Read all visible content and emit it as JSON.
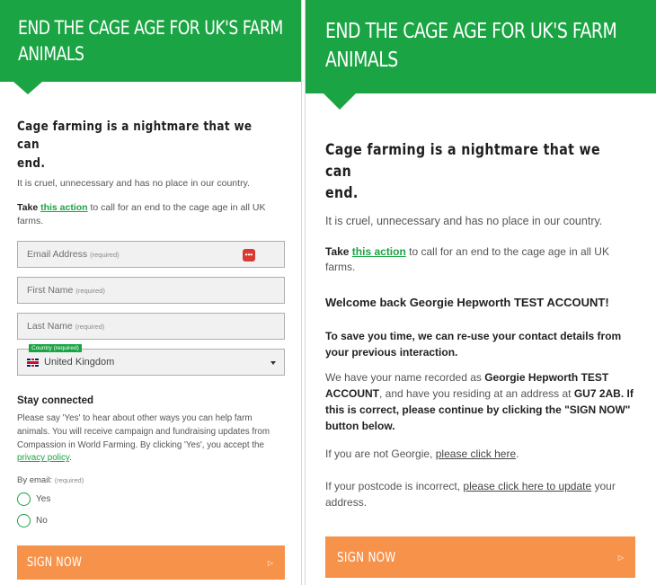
{
  "heading": "END THE CAGE AGE FOR UK'S FARM ANIMALS",
  "heading_line1": "END THE CAGE AGE FOR UK'S FARM",
  "heading_line2": "ANIMALS",
  "title_line1": "Cage farming is a nightmare that we can",
  "title_line2": "end.",
  "subtitle": "It is cruel, unnecessary and has no place in our country.",
  "take": {
    "prefix": "Take ",
    "link": "this action",
    "suffix_left": " to call for an end to the cage age in all UK farms.",
    "suffix_right": " to call for an end to the cage age in all UK farms."
  },
  "form": {
    "email": {
      "label": "Email Address",
      "required": "(required)",
      "icon": "password-manager-icon"
    },
    "first_name": {
      "label": "First Name",
      "required": "(required)"
    },
    "last_name": {
      "label": "Last Name",
      "required": "(required)"
    },
    "country": {
      "tag": "Country (required)",
      "value": "United Kingdom",
      "icon": "uk-flag-icon"
    }
  },
  "stay": {
    "heading": "Stay connected",
    "text": "Please say 'Yes' to hear about other ways you can help farm animals. You will receive campaign and fundraising updates from Compassion in World Farming. By clicking 'Yes', you accept the ",
    "policy_link": "privacy policy",
    "policy_end": ".",
    "by_email": "By email:",
    "by_email_req": "(required)",
    "options": [
      "Yes",
      "No"
    ]
  },
  "sign_now": "SIGN NOW",
  "arrow": "▷",
  "right": {
    "welcome": "Welcome back Georgie Hepworth TEST ACCOUNT!",
    "save": "To save you time, we can re-use your contact details from your previous interaction.",
    "recorded_p1": "We have your name recorded as ",
    "recorded_name": "Georgie Hepworth TEST ACCOUNT",
    "recorded_p2": ", and have you residing at an address at ",
    "recorded_bold": "GU7 2AB. If this is correct, please continue by clicking the \"SIGN NOW\" button below.",
    "not_georgie": "If you are not Georgie, ",
    "not_georgie_link": "please click here",
    "not_georgie_end": ".",
    "postcode": "If your postcode is incorrect, ",
    "postcode_link": "please click here to update",
    "postcode_end": " your address."
  },
  "colors": {
    "brand_green": "#1aa443",
    "button_orange": "#f7924a",
    "alert_red": "#d83a34"
  }
}
